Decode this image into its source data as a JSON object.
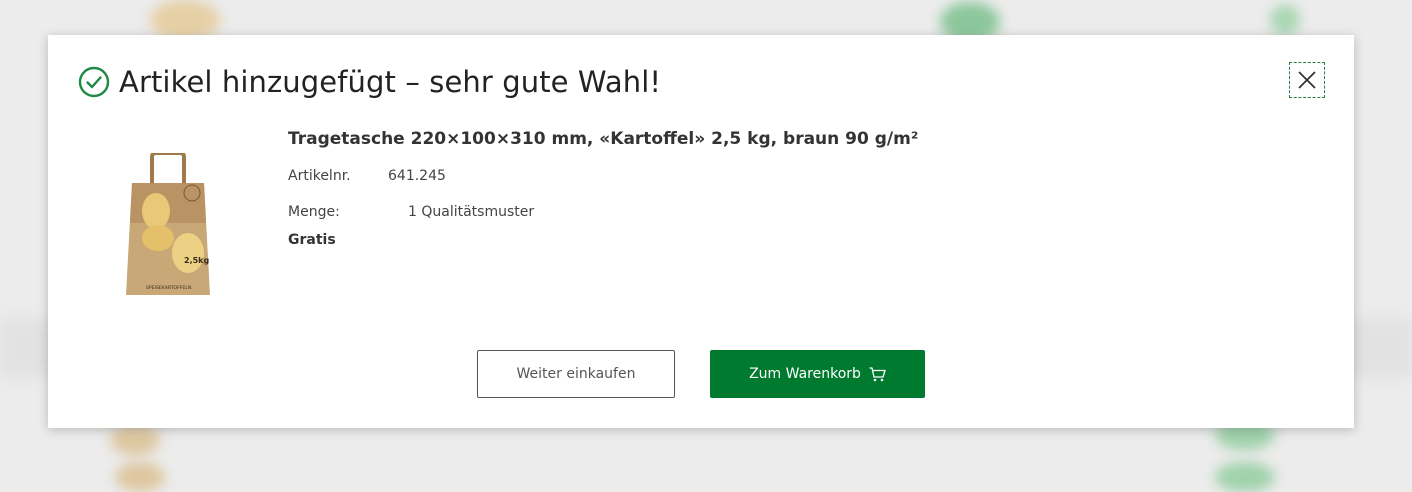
{
  "modal": {
    "title": "Artikel hinzugefügt – sehr gute Wahl!",
    "close_label": "Schließen"
  },
  "product": {
    "name": "Tragetasche 220×100×310 mm, «Kartoffel» 2,5 kg, braun 90 g/m²",
    "article_label": "Artikelnr.",
    "article_number": "641.245",
    "quantity_label": "Menge:",
    "quantity_value": "1 Qualitätsmuster",
    "price": "Gratis",
    "image_text": {
      "weight": "2,5kg",
      "bottom": "SPEISEKARTOFFELN"
    }
  },
  "actions": {
    "continue_label": "Weiter einkaufen",
    "cart_label": "Zum Warenkorb"
  },
  "colors": {
    "accent": "#007a2f",
    "check": "#1f8a45"
  },
  "icons": [
    "check-circle-icon",
    "close-icon",
    "cart-icon"
  ]
}
